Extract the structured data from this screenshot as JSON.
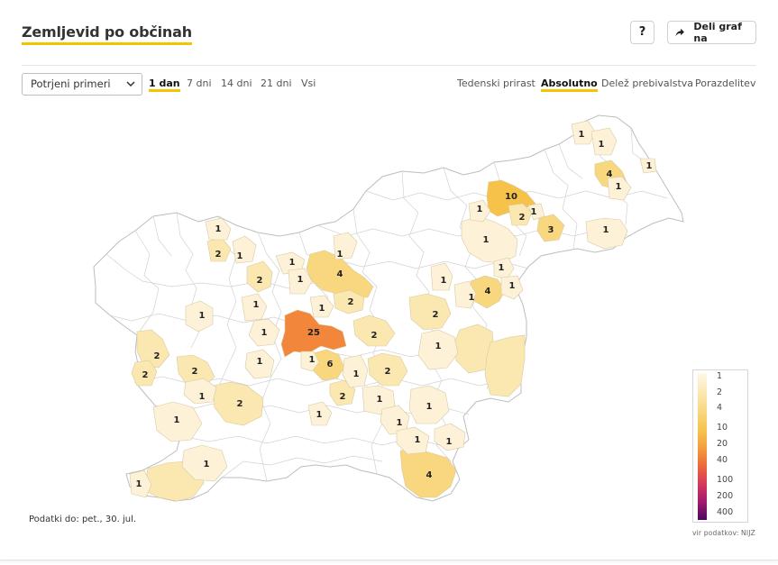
{
  "header": {
    "title": "Zemljevid po občinah",
    "help_label": "?",
    "share_label": "Deli graf na",
    "share_icon": "share-arrow-icon"
  },
  "controls": {
    "metric_select": {
      "value": "Potrjeni primeri",
      "icon": "chevron-down-icon"
    },
    "period_tabs": [
      {
        "label": "1 dan",
        "active": true
      },
      {
        "label": "7 dni",
        "active": false
      },
      {
        "label": "14 dni",
        "active": false
      },
      {
        "label": "21 dni",
        "active": false
      },
      {
        "label": "Vsi",
        "active": false
      }
    ],
    "mode_tabs": [
      {
        "label": "Tedenski prirast",
        "active": false
      },
      {
        "label": "Absolutno",
        "active": true
      },
      {
        "label": "Delež prebivalstva",
        "active": false
      },
      {
        "label": "Porazdelitev",
        "active": false
      }
    ]
  },
  "map": {
    "region_values": [
      "1",
      "1",
      "1",
      "4",
      "1",
      "10",
      "2",
      "1",
      "3",
      "1",
      "1",
      "1",
      "1",
      "4",
      "1",
      "1",
      "2",
      "1",
      "1",
      "1",
      "1",
      "4",
      "2",
      "1",
      "1",
      "2",
      "1",
      "2",
      "25",
      "1",
      "2",
      "2",
      "1",
      "1",
      "6",
      "1",
      "2",
      "2",
      "2",
      "1",
      "1",
      "2",
      "1",
      "1",
      "1",
      "1",
      "1",
      "1",
      "2",
      "1",
      "1",
      "1",
      "1",
      "1",
      "4"
    ],
    "scale_colors": {
      "c1": "#fdf2d7",
      "c2": "#fbe7b0",
      "c4": "#f8d77f",
      "c10": "#f6c24a",
      "c25": "#f2863a"
    }
  },
  "legend": {
    "labels": [
      "1",
      "2",
      "4",
      "10",
      "20",
      "40",
      "100",
      "200",
      "400"
    ]
  },
  "footnote": "Podatki do: pet., 30. jul.",
  "source": "vir podatkov: NIJZ"
}
